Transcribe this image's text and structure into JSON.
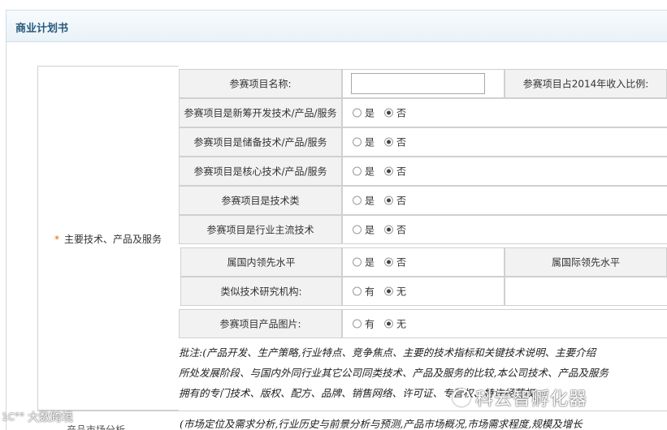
{
  "header": {
    "title": "商业计划书"
  },
  "section_label": {
    "required_mark": "*",
    "text": "主要技术、产品及服务"
  },
  "rows": {
    "project_name": {
      "label": "参赛项目名称:",
      "value": "",
      "right_label": "参赛项目占2014年收入比例:"
    },
    "new_tech": {
      "label": "参赛项目是新筹开发技术/产品/服务",
      "opt_yes": "是",
      "opt_no": "否",
      "selected": "否"
    },
    "reserve_tech": {
      "label": "参赛项目是储备技术/产品/服务",
      "opt_yes": "是",
      "opt_no": "否",
      "selected": "否"
    },
    "core_tech": {
      "label": "参赛项目是核心技术/产品/服务",
      "opt_yes": "是",
      "opt_no": "否",
      "selected": "否"
    },
    "tech_type": {
      "label": "参赛项目是技术类",
      "opt_yes": "是",
      "opt_no": "否",
      "selected": "否"
    },
    "mainstream": {
      "label": "参赛项目是行业主流技术",
      "opt_yes": "是",
      "opt_no": "否",
      "selected": "否"
    },
    "domestic_lead": {
      "label": "属国内领先水平",
      "opt_yes": "是",
      "opt_no": "否",
      "selected": "否",
      "right_label": "属国际领先水平"
    },
    "similar_inst": {
      "label": "类似技术研究机构:",
      "opt_yes": "有",
      "opt_no": "无",
      "selected": "无"
    },
    "product_image": {
      "label": "参赛项目产品图片:",
      "opt_yes": "有",
      "opt_no": "无",
      "selected": "无"
    }
  },
  "notes": {
    "line1": "批注:(产品开发、生产策略,行业特点、竞争焦点、主要的技术指标和关键技术说明、主要介绍",
    "line2": "所处发展阶段、与国内外同行业其它公司同类技术、产品及服务的比较,本公司技术、产品及服务",
    "line3": "拥有的专门技术、版权、配方、品牌、销售网络、许可证、专营权、特许经营权"
  },
  "bottom": {
    "label": "产品市场分析",
    "text": "(市场定位及需求分析,行业历史与前景分析与预测,产品市场概况,市场需求程度,规模及增长"
  },
  "watermarks": {
    "left": "大数跨境",
    "left_logo": "1C°°",
    "right": "科云智孵化器"
  }
}
